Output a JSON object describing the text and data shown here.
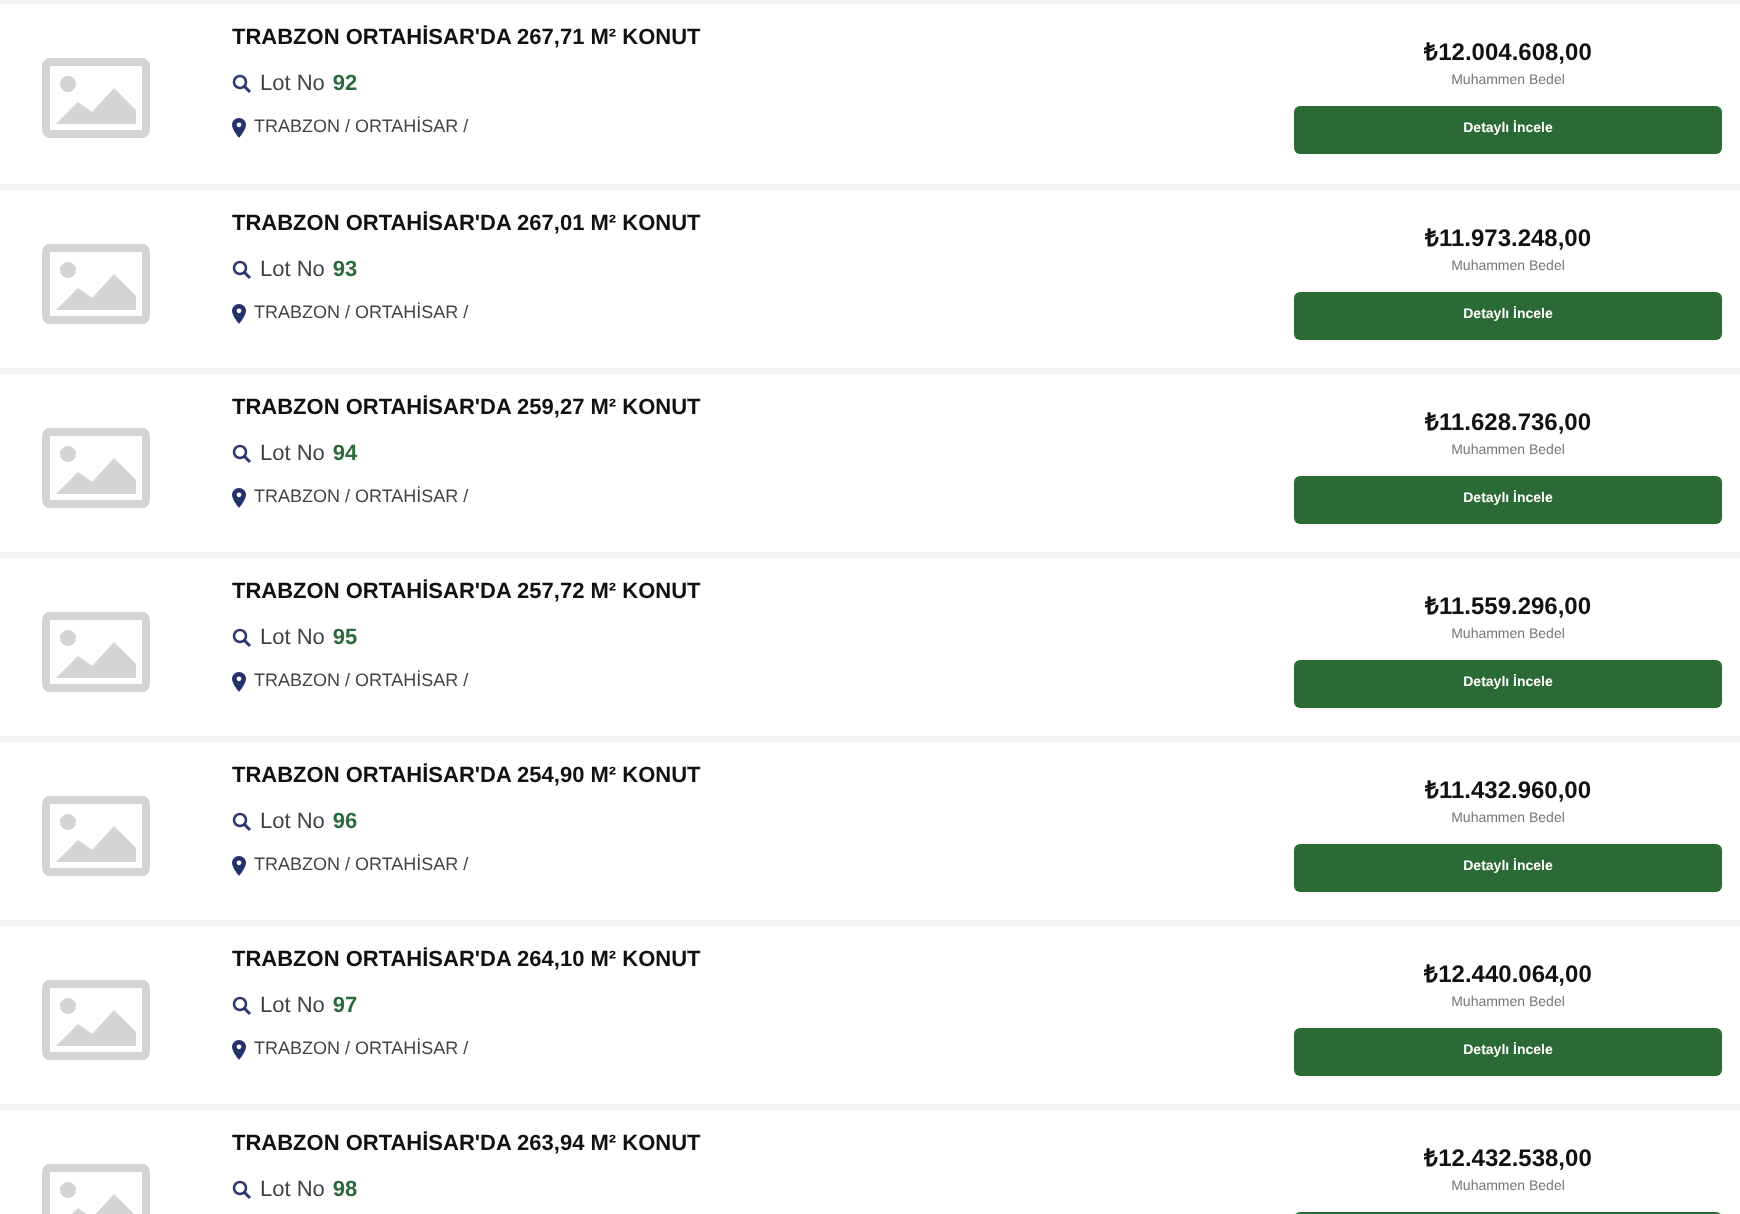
{
  "listings": [
    {
      "title": "TRABZON ORTAHİSAR'DA 267,71 M² KONUT",
      "lot_label": "Lot No",
      "lot_number": "92",
      "location": "TRABZON / ORTAHİSAR /",
      "price": "₺12.004.608,00",
      "price_label": "Muhammen Bedel",
      "button_label": "Detaylı İncele"
    },
    {
      "title": "TRABZON ORTAHİSAR'DA 267,01 M² KONUT",
      "lot_label": "Lot No",
      "lot_number": "93",
      "location": "TRABZON / ORTAHİSAR /",
      "price": "₺11.973.248,00",
      "price_label": "Muhammen Bedel",
      "button_label": "Detaylı İncele"
    },
    {
      "title": "TRABZON ORTAHİSAR'DA 259,27 M² KONUT",
      "lot_label": "Lot No",
      "lot_number": "94",
      "location": "TRABZON / ORTAHİSAR /",
      "price": "₺11.628.736,00",
      "price_label": "Muhammen Bedel",
      "button_label": "Detaylı İncele"
    },
    {
      "title": "TRABZON ORTAHİSAR'DA 257,72 M² KONUT",
      "lot_label": "Lot No",
      "lot_number": "95",
      "location": "TRABZON / ORTAHİSAR /",
      "price": "₺11.559.296,00",
      "price_label": "Muhammen Bedel",
      "button_label": "Detaylı İncele"
    },
    {
      "title": "TRABZON ORTAHİSAR'DA 254,90 M² KONUT",
      "lot_label": "Lot No",
      "lot_number": "96",
      "location": "TRABZON / ORTAHİSAR /",
      "price": "₺11.432.960,00",
      "price_label": "Muhammen Bedel",
      "button_label": "Detaylı İncele"
    },
    {
      "title": "TRABZON ORTAHİSAR'DA 264,10 M² KONUT",
      "lot_label": "Lot No",
      "lot_number": "97",
      "location": "TRABZON / ORTAHİSAR /",
      "price": "₺12.440.064,00",
      "price_label": "Muhammen Bedel",
      "button_label": "Detaylı İncele"
    },
    {
      "title": "TRABZON ORTAHİSAR'DA 263,94 M² KONUT",
      "lot_label": "Lot No",
      "lot_number": "98",
      "price": "₺12.432.538,00",
      "price_label": "Muhammen Bedel"
    }
  ]
}
